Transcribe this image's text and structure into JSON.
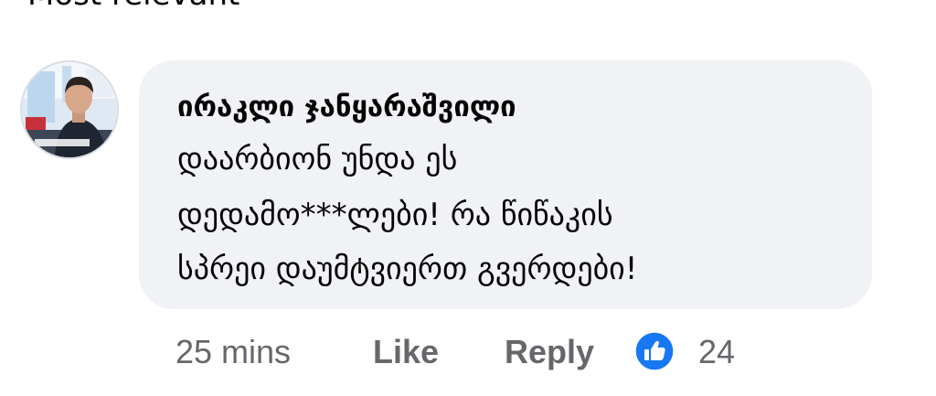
{
  "previous_text": "Most relevant",
  "comment": {
    "author": "ირაკლი ჯანყარაშვილი",
    "lines": [
      "დაარბიონ უნდა ეს",
      "დედამო***ლები! რა წიწაკის",
      "სპრეი დაუმტვიერთ გვერდები!"
    ],
    "avatar_icon": "user-avatar-photo"
  },
  "actions": {
    "time": "25 mins",
    "like_label": "Like",
    "reply_label": "Reply",
    "reaction_icon": "thumbs-up-icon",
    "reaction_count": "24"
  },
  "colors": {
    "bubble": "#f0f2f5",
    "meta_text": "#65676b",
    "reaction_blue": "#1877f2"
  }
}
